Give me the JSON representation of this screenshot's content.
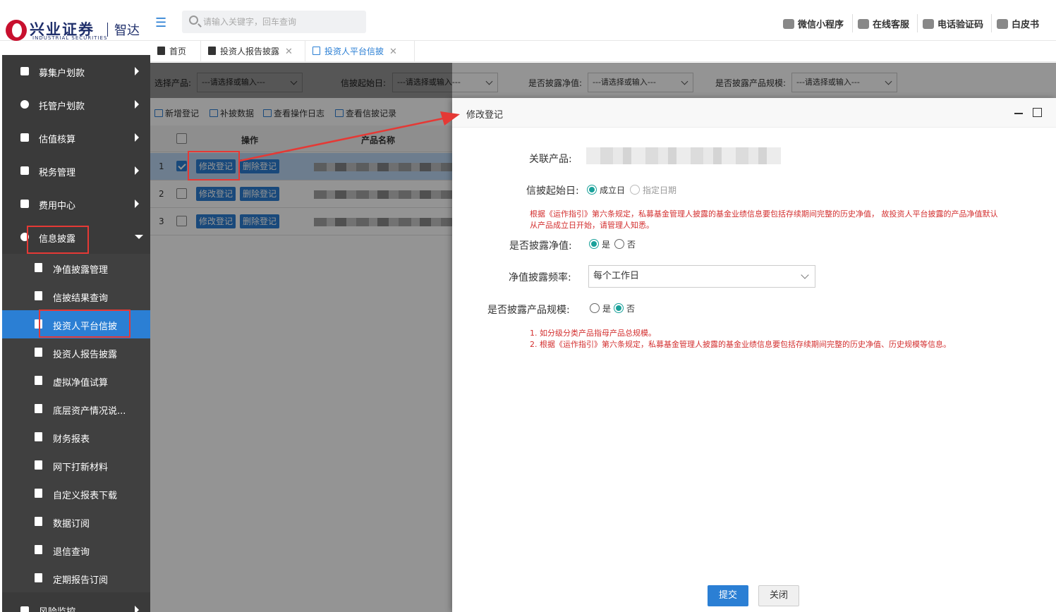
{
  "header": {
    "logo_main": "兴业证券",
    "logo_en": "INDUSTRIAL SECURITIES",
    "logo_sub": "智达",
    "search_placeholder": "请输入关键字，回车查询",
    "links": [
      "微信小程序",
      "在线客服",
      "电话验证码",
      "白皮书"
    ]
  },
  "tabs": [
    {
      "label": "首页",
      "icon": "home-icon"
    },
    {
      "label": "投资人报告披露",
      "icon": "document-icon"
    },
    {
      "label": "投资人平台信披",
      "icon": "image-icon",
      "active": true
    }
  ],
  "sidebar": {
    "items": [
      {
        "label": "募集户划款",
        "icon": "bell-icon"
      },
      {
        "label": "托管户划款",
        "icon": "target-icon"
      },
      {
        "label": "估值核算",
        "icon": "chart-icon"
      },
      {
        "label": "税务管理",
        "icon": "scale-icon"
      },
      {
        "label": "费用中心",
        "icon": "document-icon"
      },
      {
        "label": "信息披露",
        "icon": "info-icon",
        "expanded": true
      }
    ],
    "subitems": [
      {
        "label": "净值披露管理"
      },
      {
        "label": "信披结果查询"
      },
      {
        "label": "投资人平台信披",
        "active": true
      },
      {
        "label": "投资人报告披露"
      },
      {
        "label": "虚拟净值试算"
      },
      {
        "label": "底层资产情况说..."
      },
      {
        "label": "财务报表"
      },
      {
        "label": "网下打新材料"
      },
      {
        "label": "自定义报表下载"
      },
      {
        "label": "数据订阅"
      },
      {
        "label": "退信查询"
      },
      {
        "label": "定期报告订阅"
      }
    ],
    "bottom_item": "风险监控"
  },
  "filters": {
    "product_label": "选择产品:",
    "start_label": "信披起始日:",
    "nav_label": "是否披露净值:",
    "scale_label": "是否披露产品规模:",
    "placeholder": "---请选择或输入---"
  },
  "toolbar": [
    "新增登记",
    "补披数据",
    "查看操作日志",
    "查看信披记录"
  ],
  "grid": {
    "col_action": "操作",
    "col_name": "产品名称",
    "edit_label": "修改登记",
    "delete_label": "删除登记",
    "rows": [
      {
        "num": "1",
        "checked": true
      },
      {
        "num": "2",
        "checked": false
      },
      {
        "num": "3",
        "checked": false
      }
    ]
  },
  "modal": {
    "title": "修改登记",
    "related_label": "关联产品:",
    "start_label": "信披起始日:",
    "start_opt1": "成立日",
    "start_opt2": "指定日期",
    "note1_line1": "根据《运作指引》第六条规定，私募基金管理人披露的基金业绩信息要包括存续期间完整的历史净值， 故投资人平台披露的产品净值默认",
    "note1_line2": "从产品成立日开始，请管理人知悉。",
    "nav_label": "是否披露净值:",
    "yes": "是",
    "no": "否",
    "freq_label": "净值披露频率:",
    "freq_value": "每个工作日",
    "scale_label": "是否披露产品规模:",
    "note2_line1": "1. 如分级分类产品指母产品总规模。",
    "note2_line2": "2. 根据《运作指引》第六条规定，私募基金管理人披露的基金业绩信息要包括存续期间完整的历史净值、历史规模等信息。",
    "submit": "提交",
    "close": "关闭"
  },
  "colors": {
    "accent": "#2b7fd4",
    "radio": "#1aa19a",
    "note": "#d32f2f",
    "sidebar": "#3a3a3a",
    "highlight": "#e53935"
  }
}
